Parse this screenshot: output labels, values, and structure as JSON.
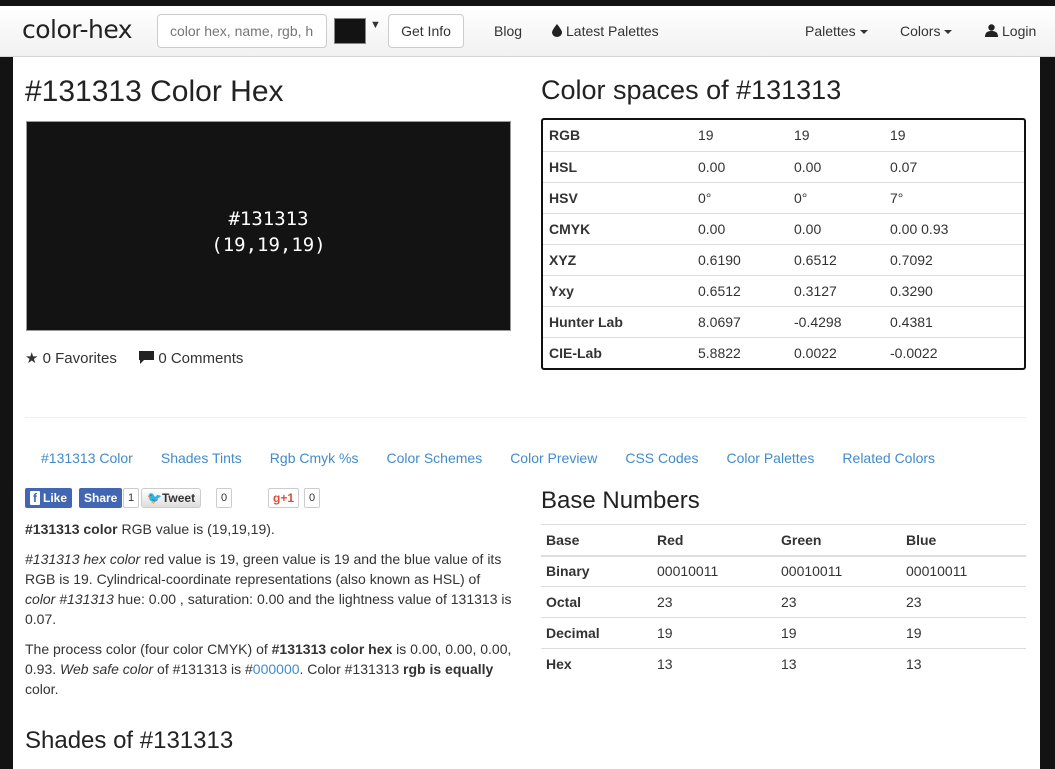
{
  "navbar": {
    "brand": "color-hex",
    "search_placeholder": "color hex, name, rgb, h",
    "swatch_color": "#131313",
    "get_info": "Get Info",
    "blog": "Blog",
    "latest_palettes": "Latest Palettes",
    "palettes": "Palettes",
    "colors": "Colors",
    "login": "Login"
  },
  "page_title": "#131313 Color Hex",
  "color_box": {
    "hex": "#131313",
    "rgb": "(19,19,19)",
    "color": "#131313"
  },
  "favorites": "0 Favorites",
  "comments": "0 Comments",
  "spaces_title": "Color spaces of #131313",
  "color_spaces": [
    {
      "label": "RGB",
      "v1": "19",
      "v2": "19",
      "v3": "19"
    },
    {
      "label": "HSL",
      "v1": "0.00",
      "v2": "0.00",
      "v3": "0.07"
    },
    {
      "label": "HSV",
      "v1": "0°",
      "v2": "0°",
      "v3": "7°"
    },
    {
      "label": "CMYK",
      "v1": "0.00",
      "v2": "0.00",
      "v3": "0.00   0.93"
    },
    {
      "label": "XYZ",
      "v1": "0.6190",
      "v2": "0.6512",
      "v3": "0.7092"
    },
    {
      "label": "Yxy",
      "v1": "0.6512",
      "v2": "0.3127",
      "v3": "0.3290"
    },
    {
      "label": "Hunter Lab",
      "v1": "8.0697",
      "v2": "-0.4298",
      "v3": "0.4381"
    },
    {
      "label": "CIE-Lab",
      "v1": "5.8822",
      "v2": "0.0022",
      "v3": "-0.0022"
    }
  ],
  "tabs": [
    "#131313 Color",
    "Shades Tints",
    "Rgb Cmyk %s",
    "Color Schemes",
    "Color Preview",
    "CSS Codes",
    "Color Palettes",
    "Related Colors"
  ],
  "share": {
    "like": "Like",
    "share": "Share",
    "share_count": "1",
    "tweet": "Tweet",
    "tweet_count": "0",
    "gplus": "+1",
    "gplus_count": "0"
  },
  "paragraph1": {
    "bold": "#131313 color",
    "rest": " RGB value is (19,19,19)."
  },
  "paragraph2": {
    "i1": "#131313 hex color",
    "t1": " red value is 19, green value is 19 and the blue value of its RGB is 19. Cylindrical-coordinate representations (also known as HSL) of ",
    "i2": "color #131313",
    "t2": " hue: 0.00 , saturation: 0.00 and the lightness value of 131313 is 0.07."
  },
  "paragraph3": {
    "t1": "The process color (four color CMYK) of ",
    "b1": "#131313 color hex",
    "t2": " is 0.00, 0.00, 0.00, 0.93. ",
    "i1": "Web safe color",
    "t3": " of #131313 is #",
    "link": "000000",
    "t4": ". Color #131313 ",
    "b2": "rgb is equally",
    "t5": " color."
  },
  "base_title": "Base Numbers",
  "base_headers": [
    "Base",
    "Red",
    "Green",
    "Blue"
  ],
  "base_rows": [
    {
      "label": "Binary",
      "r": "00010011",
      "g": "00010011",
      "b": "00010011"
    },
    {
      "label": "Octal",
      "r": "23",
      "g": "23",
      "b": "23"
    },
    {
      "label": "Decimal",
      "r": "19",
      "g": "19",
      "b": "19"
    },
    {
      "label": "Hex",
      "r": "13",
      "g": "13",
      "b": "13"
    }
  ],
  "shades_title": "Shades of #131313"
}
